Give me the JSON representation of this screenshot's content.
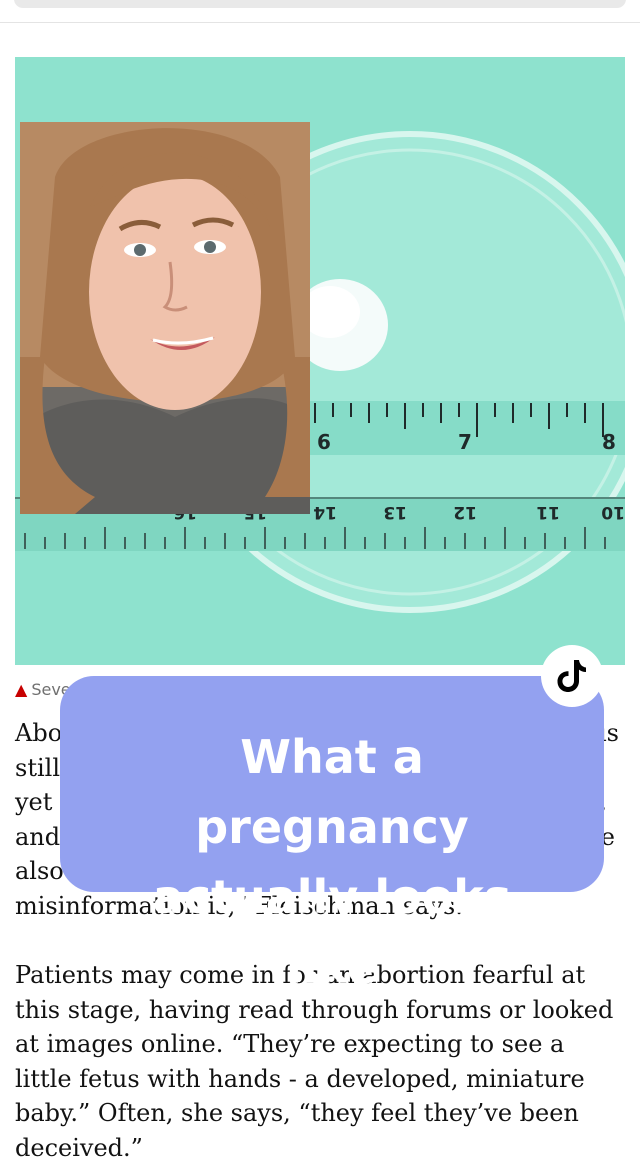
{
  "browser": {
    "chrome": "address-bar"
  },
  "photo": {
    "subject": "petri dish with tissue on measuring tape",
    "tape_numbers": [
      "6",
      "7",
      "8"
    ],
    "tape_numbers_flipped": [
      "16",
      "15",
      "14",
      "13",
      "12",
      "11",
      "10"
    ]
  },
  "caption": {
    "icon": "triangle-icon",
    "text": "Seve"
  },
  "article": {
    "paragraph1": {
      "lines": [
        "Abo",
        "still",
        "yet",
        "and",
        "also s"
      ],
      "right_fragments": [
        "is",
        "",
        ",",
        "e"
      ],
      "last_line": "misinformation is,” Fleischman says."
    },
    "paragraph2": "Patients may come in for an abortion fearful at this stage, having read through forums or looked at images online. “They’re expecting to see a little fetus with hands - a developed, miniature baby.” Often, she says, “they feel they’ve been deceived.”"
  },
  "overlay": {
    "title": "What a pregnancy actually looks like",
    "color": "#93a1f0"
  },
  "tiktok": {
    "icon": "tiktok-logo-icon"
  }
}
